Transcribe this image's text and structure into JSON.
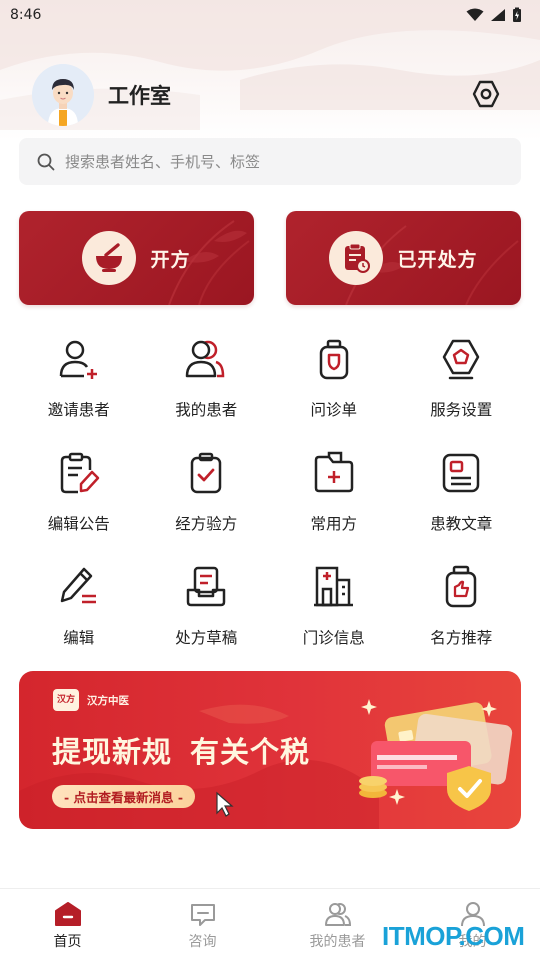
{
  "status_bar": {
    "time": "8:46"
  },
  "header": {
    "title": "工作室"
  },
  "search": {
    "placeholder": "搜索患者姓名、手机号、标签"
  },
  "primary_actions": [
    {
      "label": "开方"
    },
    {
      "label": "已开处方"
    }
  ],
  "grid": [
    {
      "label": "邀请患者",
      "icon": "invite-patient-icon"
    },
    {
      "label": "我的患者",
      "icon": "my-patients-icon"
    },
    {
      "label": "问诊单",
      "icon": "consult-form-icon"
    },
    {
      "label": "服务设置",
      "icon": "service-settings-icon"
    },
    {
      "label": "编辑公告",
      "icon": "edit-notice-icon"
    },
    {
      "label": "经方验方",
      "icon": "classic-prescription-icon"
    },
    {
      "label": "常用方",
      "icon": "common-prescription-icon"
    },
    {
      "label": "患教文章",
      "icon": "patient-education-icon"
    },
    {
      "label": "编辑",
      "icon": "edit-icon"
    },
    {
      "label": "处方草稿",
      "icon": "prescription-draft-icon"
    },
    {
      "label": "门诊信息",
      "icon": "clinic-info-icon"
    },
    {
      "label": "名方推荐",
      "icon": "famous-prescription-icon"
    }
  ],
  "banner": {
    "brand_logo": "汉方",
    "brand_name": "汉方中医",
    "headline_part1": "提现新规",
    "headline_part2": "有关个税",
    "cta": "- 点击查看最新消息 -"
  },
  "tabbar": [
    {
      "label": "首页",
      "active": true
    },
    {
      "label": "咨询",
      "active": false
    },
    {
      "label": "我的患者",
      "active": false
    },
    {
      "label": "我的",
      "active": false
    }
  ],
  "watermark": "ITMOP.COM",
  "colors": {
    "brand_red": "#a81c27",
    "accent_cream": "#fbeadb",
    "tab_inactive": "#9a9a9a"
  }
}
